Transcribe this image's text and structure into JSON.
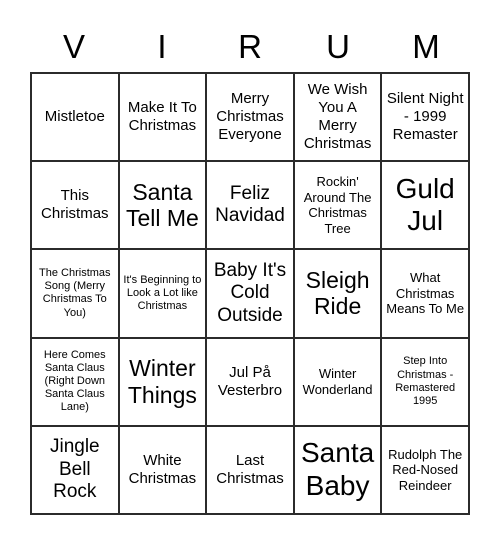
{
  "card": {
    "header_letters": [
      "V",
      "I",
      "R",
      "U",
      "M"
    ],
    "rows": [
      [
        {
          "label": "Mistletoe",
          "size": "fs-md"
        },
        {
          "label": "Make It To Christmas",
          "size": "fs-md"
        },
        {
          "label": "Merry Christmas Everyone",
          "size": "fs-md"
        },
        {
          "label": "We Wish You A Merry Christmas",
          "size": "fs-md"
        },
        {
          "label": "Silent Night - 1999 Remaster",
          "size": "fs-md"
        }
      ],
      [
        {
          "label": "This Christmas",
          "size": "fs-md"
        },
        {
          "label": "Santa Tell Me",
          "size": "fs-xl"
        },
        {
          "label": "Feliz Navidad",
          "size": "fs-lg"
        },
        {
          "label": "Rockin' Around The Christmas Tree",
          "size": "fs-sm"
        },
        {
          "label": "Guld Jul",
          "size": "fs-xxl"
        }
      ],
      [
        {
          "label": "The Christmas Song (Merry Christmas To You)",
          "size": "fs-xs"
        },
        {
          "label": "It's Beginning to Look a Lot like Christmas",
          "size": "fs-xs"
        },
        {
          "label": "Baby It's Cold Outside",
          "size": "fs-lg"
        },
        {
          "label": "Sleigh Ride",
          "size": "fs-xl"
        },
        {
          "label": "What Christmas Means To Me",
          "size": "fs-sm"
        }
      ],
      [
        {
          "label": "Here Comes Santa Claus (Right Down Santa Claus Lane)",
          "size": "fs-xs"
        },
        {
          "label": "Winter Things",
          "size": "fs-xl"
        },
        {
          "label": "Jul På Vesterbro",
          "size": "fs-md"
        },
        {
          "label": "Winter Wonderland",
          "size": "fs-sm"
        },
        {
          "label": "Step Into Christmas - Remastered 1995",
          "size": "fs-xs"
        }
      ],
      [
        {
          "label": "Jingle Bell Rock",
          "size": "fs-lg"
        },
        {
          "label": "White Christmas",
          "size": "fs-md"
        },
        {
          "label": "Last Christmas",
          "size": "fs-md"
        },
        {
          "label": "Santa Baby",
          "size": "fs-xxl"
        },
        {
          "label": "Rudolph The Red-Nosed Reindeer",
          "size": "fs-sm"
        }
      ]
    ],
    "colors": {
      "border": "#2b2b2b",
      "background": "#ffffff",
      "text": "#000000"
    }
  }
}
